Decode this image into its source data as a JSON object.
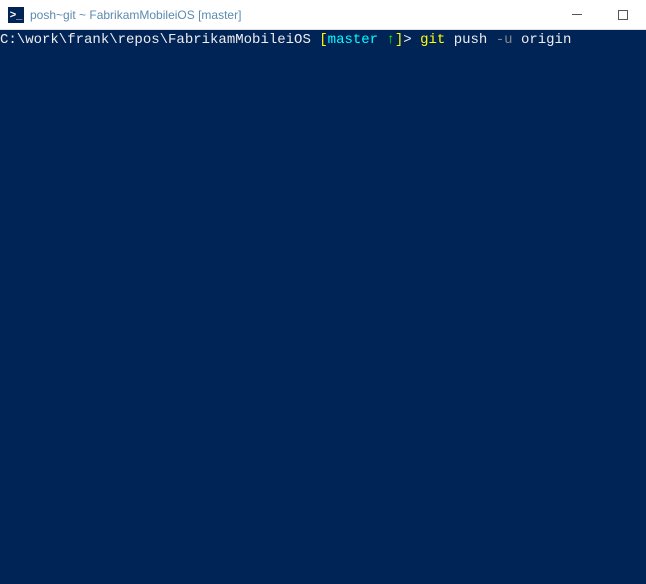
{
  "window": {
    "title": "posh~git ~ FabrikamMobileiOS [master]",
    "icon_glyph": ">_"
  },
  "prompt": {
    "path": "C:\\work\\frank\\repos\\FabrikamMobileiOS",
    "branch_open": " [",
    "branch_name": "master ",
    "branch_arrow": "↑",
    "branch_close": "]",
    "angle": "> "
  },
  "command": {
    "git": "git ",
    "push": "push ",
    "flag": "-u ",
    "origin": "origin"
  }
}
